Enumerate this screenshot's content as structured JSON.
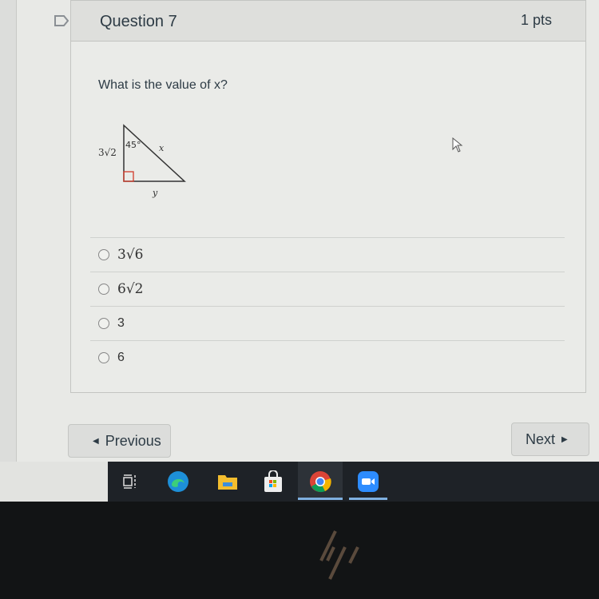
{
  "question": {
    "title": "Question 7",
    "points": "1 pts",
    "text": "What is the value of x?",
    "figure": {
      "side_label": "3√2",
      "angle_label": "45°",
      "hypotenuse_label": "x",
      "base_label": "y"
    },
    "answers": [
      {
        "label": "3√6"
      },
      {
        "label": "6√2"
      },
      {
        "label": "3"
      },
      {
        "label": "6"
      }
    ]
  },
  "nav": {
    "previous_label": "Previous",
    "next_label": "Next"
  },
  "taskbar": {
    "icons": [
      "task-view-icon",
      "edge-icon",
      "file-explorer-icon",
      "store-icon",
      "chrome-icon",
      "zoom-icon"
    ]
  },
  "colors": {
    "right_angle_marker": "#d23b2a",
    "taskbar_bg": "#1e2227",
    "active_underline": "#7fb0e0"
  }
}
